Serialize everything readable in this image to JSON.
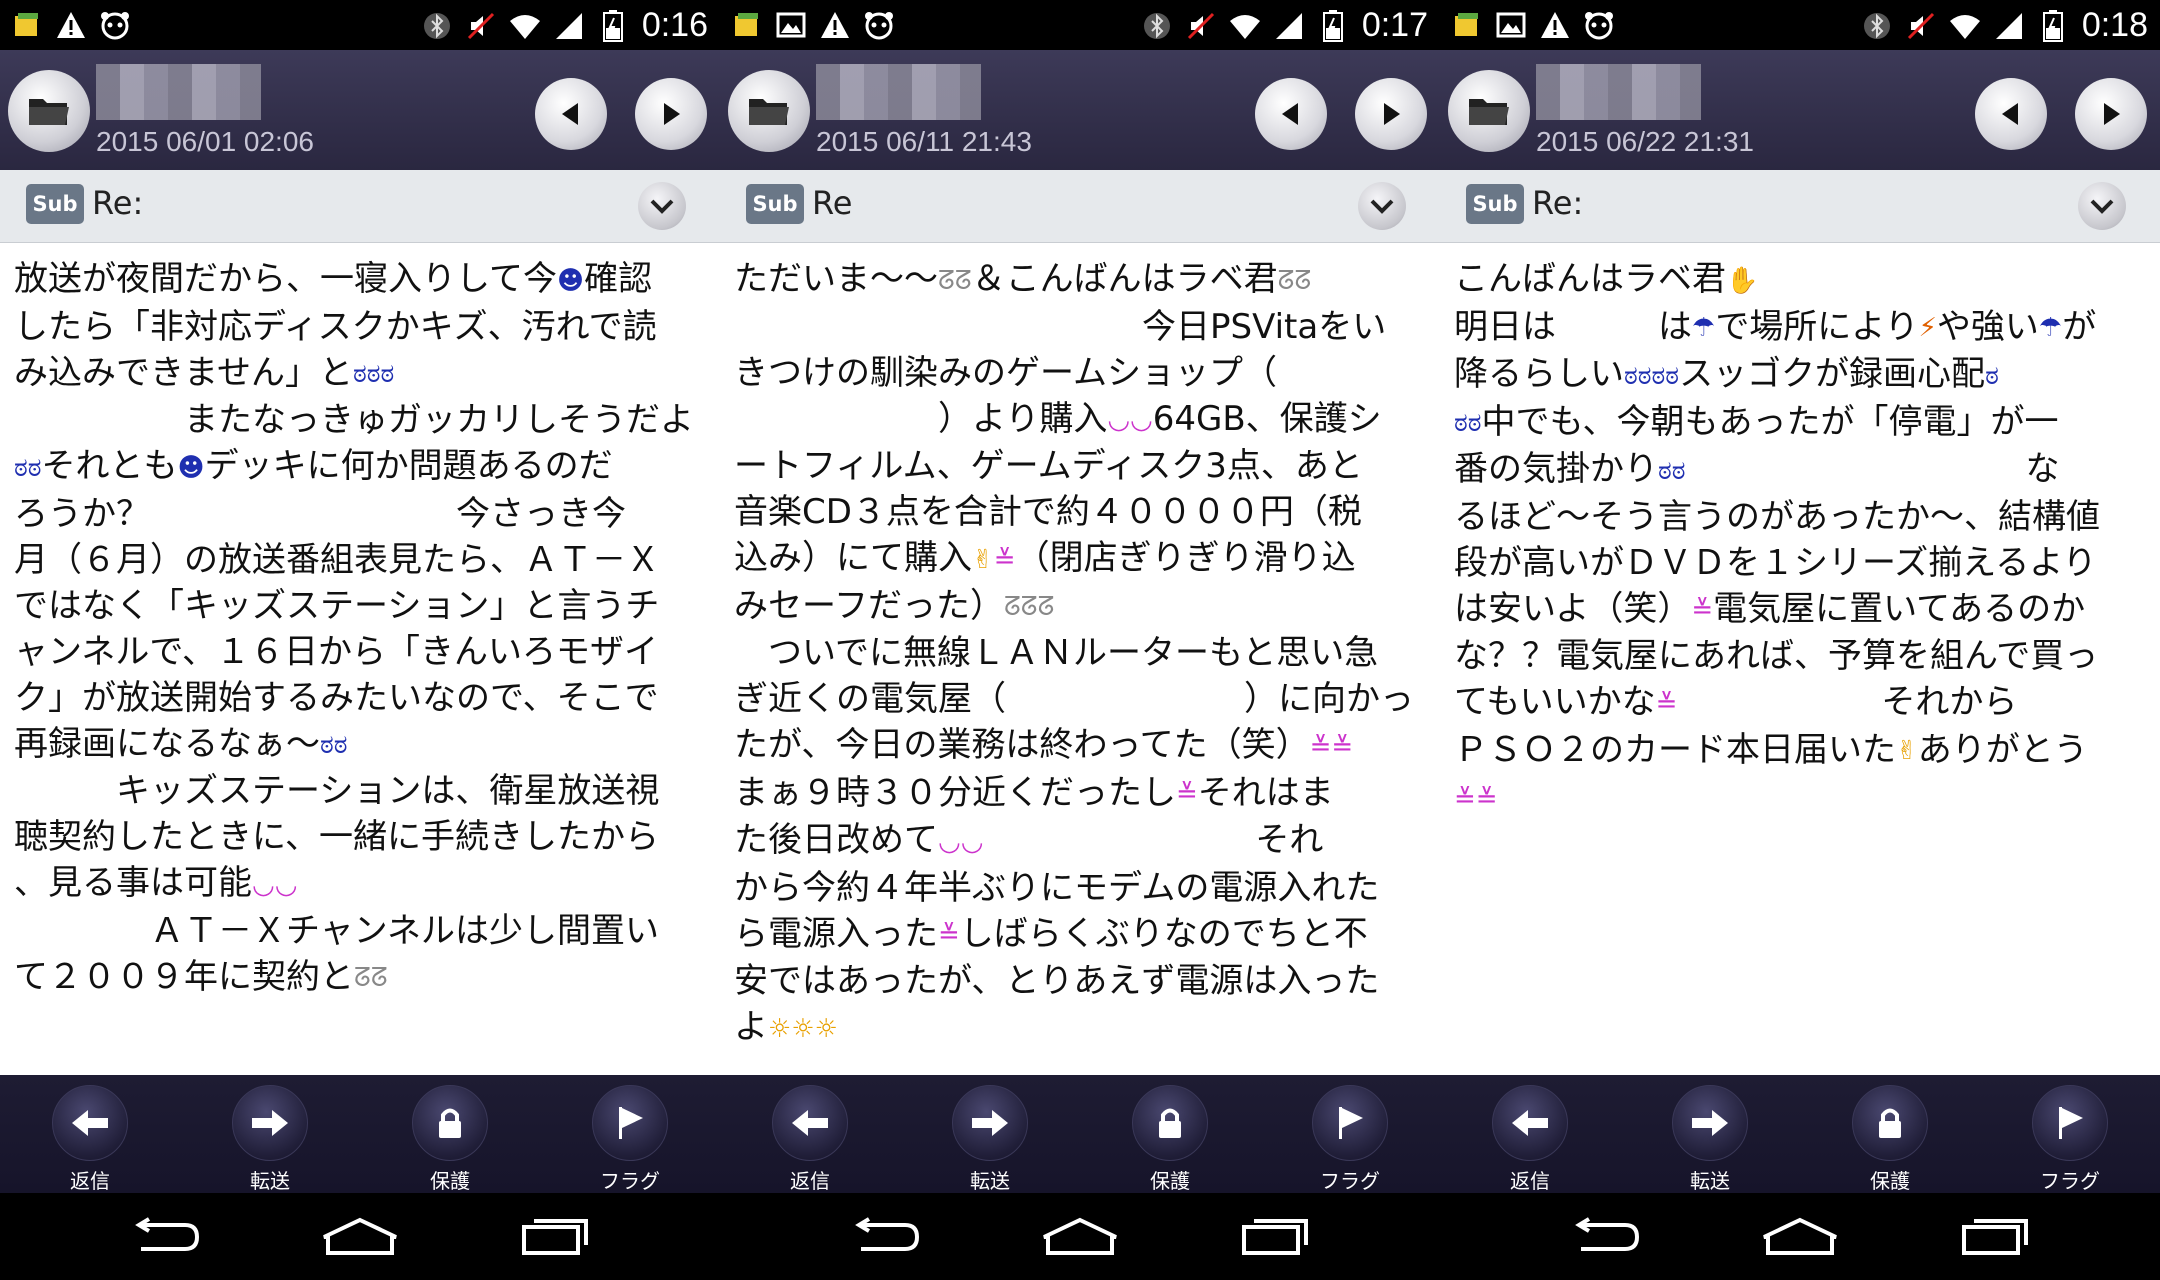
{
  "screens": [
    {
      "time": "0:16",
      "date": "2015 06/01 02:06",
      "subject_badge": "Sub",
      "subject": "Re:",
      "body_lines": [
        "放送が夜間だから、一寝入りして今[face-icon]確認",
        "したら「非対応ディスクかキズ、汚れで読",
        "み込みできません」と[sad][sad][sad]",
        "　　　　　またなっきゅガッカリしそうだよ",
        "[sad][sad]それとも[face-icon]デッキに何か問題あるのだ",
        "ろうか？　　　　　　　　　今さっき今",
        "月（６月）の放送番組表見たら、ＡＴ－Ｘ",
        "ではなく「キッズステーション」と言うチ",
        "ャンネルで、１６日から「きんいろモザイ",
        "ク」が放送開始するみたいなので、そこで",
        "再録画になるなぁ～[sad][sad]",
        "　　　キッズステーションは、衛星放送視",
        "聴契約したときに、一緒に手続きしたから",
        "、見る事は可能[smile][smile]",
        "　　　　ＡＴ－Ｘチャンネルは少し間置い",
        "て２００９年に契約と[sweat][sweat]"
      ]
    },
    {
      "time": "0:17",
      "date": "2015 06/11 21:43",
      "subject_badge": "Sub",
      "subject": "Re",
      "body_lines": [
        "ただいま～～[sweat][sweat]＆こんばんはラベ君[sweat][sweat]",
        "　　　　　　　　　　　　今日PSVitaをい",
        "きつけの馴染みのゲームショップ（",
        "　　　　　　）より購入[smile][smile]64GB、保護シ",
        "ートフィルム、ゲームディスク3点、あと",
        "音楽CD３点を合計で約４００００円（税",
        "込み）にて購入[ok-hand][happy]（閉店ぎりぎり滑り込",
        "みセーフだった）[sweat][sweat][sweat]",
        "　ついでに無線ＬＡＮルーターもと思い急",
        "ぎ近くの電気屋（　　　　　　　）に向かっ",
        "たが、今日の業務は終わってた（笑）[happy][happy]",
        "まぁ９時３０分近くだったし[happy]それはま",
        "た後日改めて[smile][smile]　　　　　　　　それ",
        "から今約４年半ぶりにモデムの電源入れた",
        "ら電源入った[happy]しばらくぶりなのでちと不",
        "安ではあったが、とりあえず電源は入った",
        "よ[bulb][bulb][bulb]"
      ]
    },
    {
      "time": "0:18",
      "date": "2015 06/22 21:31",
      "subject_badge": "Sub",
      "subject": "Re:",
      "body_lines": [
        "こんばんはラベ君[hand]",
        "明日は　　　は[umbrella]で場所により[bolt]や強い[umbrella]が",
        "降るらしい[sad][sad][sad][sad]スッゴクが録画心配[sad]",
        "[sad][sad]中でも、今朝もあったが「停電」が一",
        "番の気掛かり[sad][sad]　　　　　　　　　　な",
        "るほど～そう言うのがあったか～、結構値",
        "段が高いがＤＶＤを１シリーズ揃えるより",
        "は安いよ（笑）[happy]電気屋に置いてあるのか",
        "な？？電気屋にあれば、予算を組んで買っ",
        "てもいいかな[happy]　　　　　　それから",
        "ＰＳＯ２のカード本日届いた[ok-hand]ありがとう",
        "[happy][happy]"
      ]
    }
  ],
  "actions": [
    {
      "label": "返信",
      "icon": "reply-icon"
    },
    {
      "label": "転送",
      "icon": "forward-icon"
    },
    {
      "label": "保護",
      "icon": "lock-icon"
    },
    {
      "label": "フラグ",
      "icon": "flag-icon"
    }
  ],
  "emoji_map": {
    "face-icon": "☻",
    "sad": "ಠ",
    "smile": "◡",
    "sweat": "ᘔ",
    "happy": "≚",
    "ok-hand": "✌",
    "bulb": "☼",
    "hand": "✋",
    "umbrella": "☂",
    "bolt": "⚡"
  },
  "colors": {
    "header_bg": "#2f2c48",
    "subject_bg": "#e6e9ec",
    "actionbar_bg": "#1b1930",
    "sad": "#1f2fb0",
    "smile": "#cc33cc",
    "sweat": "#888888",
    "bulb": "#e8a000",
    "umbrella": "#1f2fb0",
    "bolt": "#e06000",
    "hand": "#e8a000",
    "face": "#1f2fb0"
  }
}
